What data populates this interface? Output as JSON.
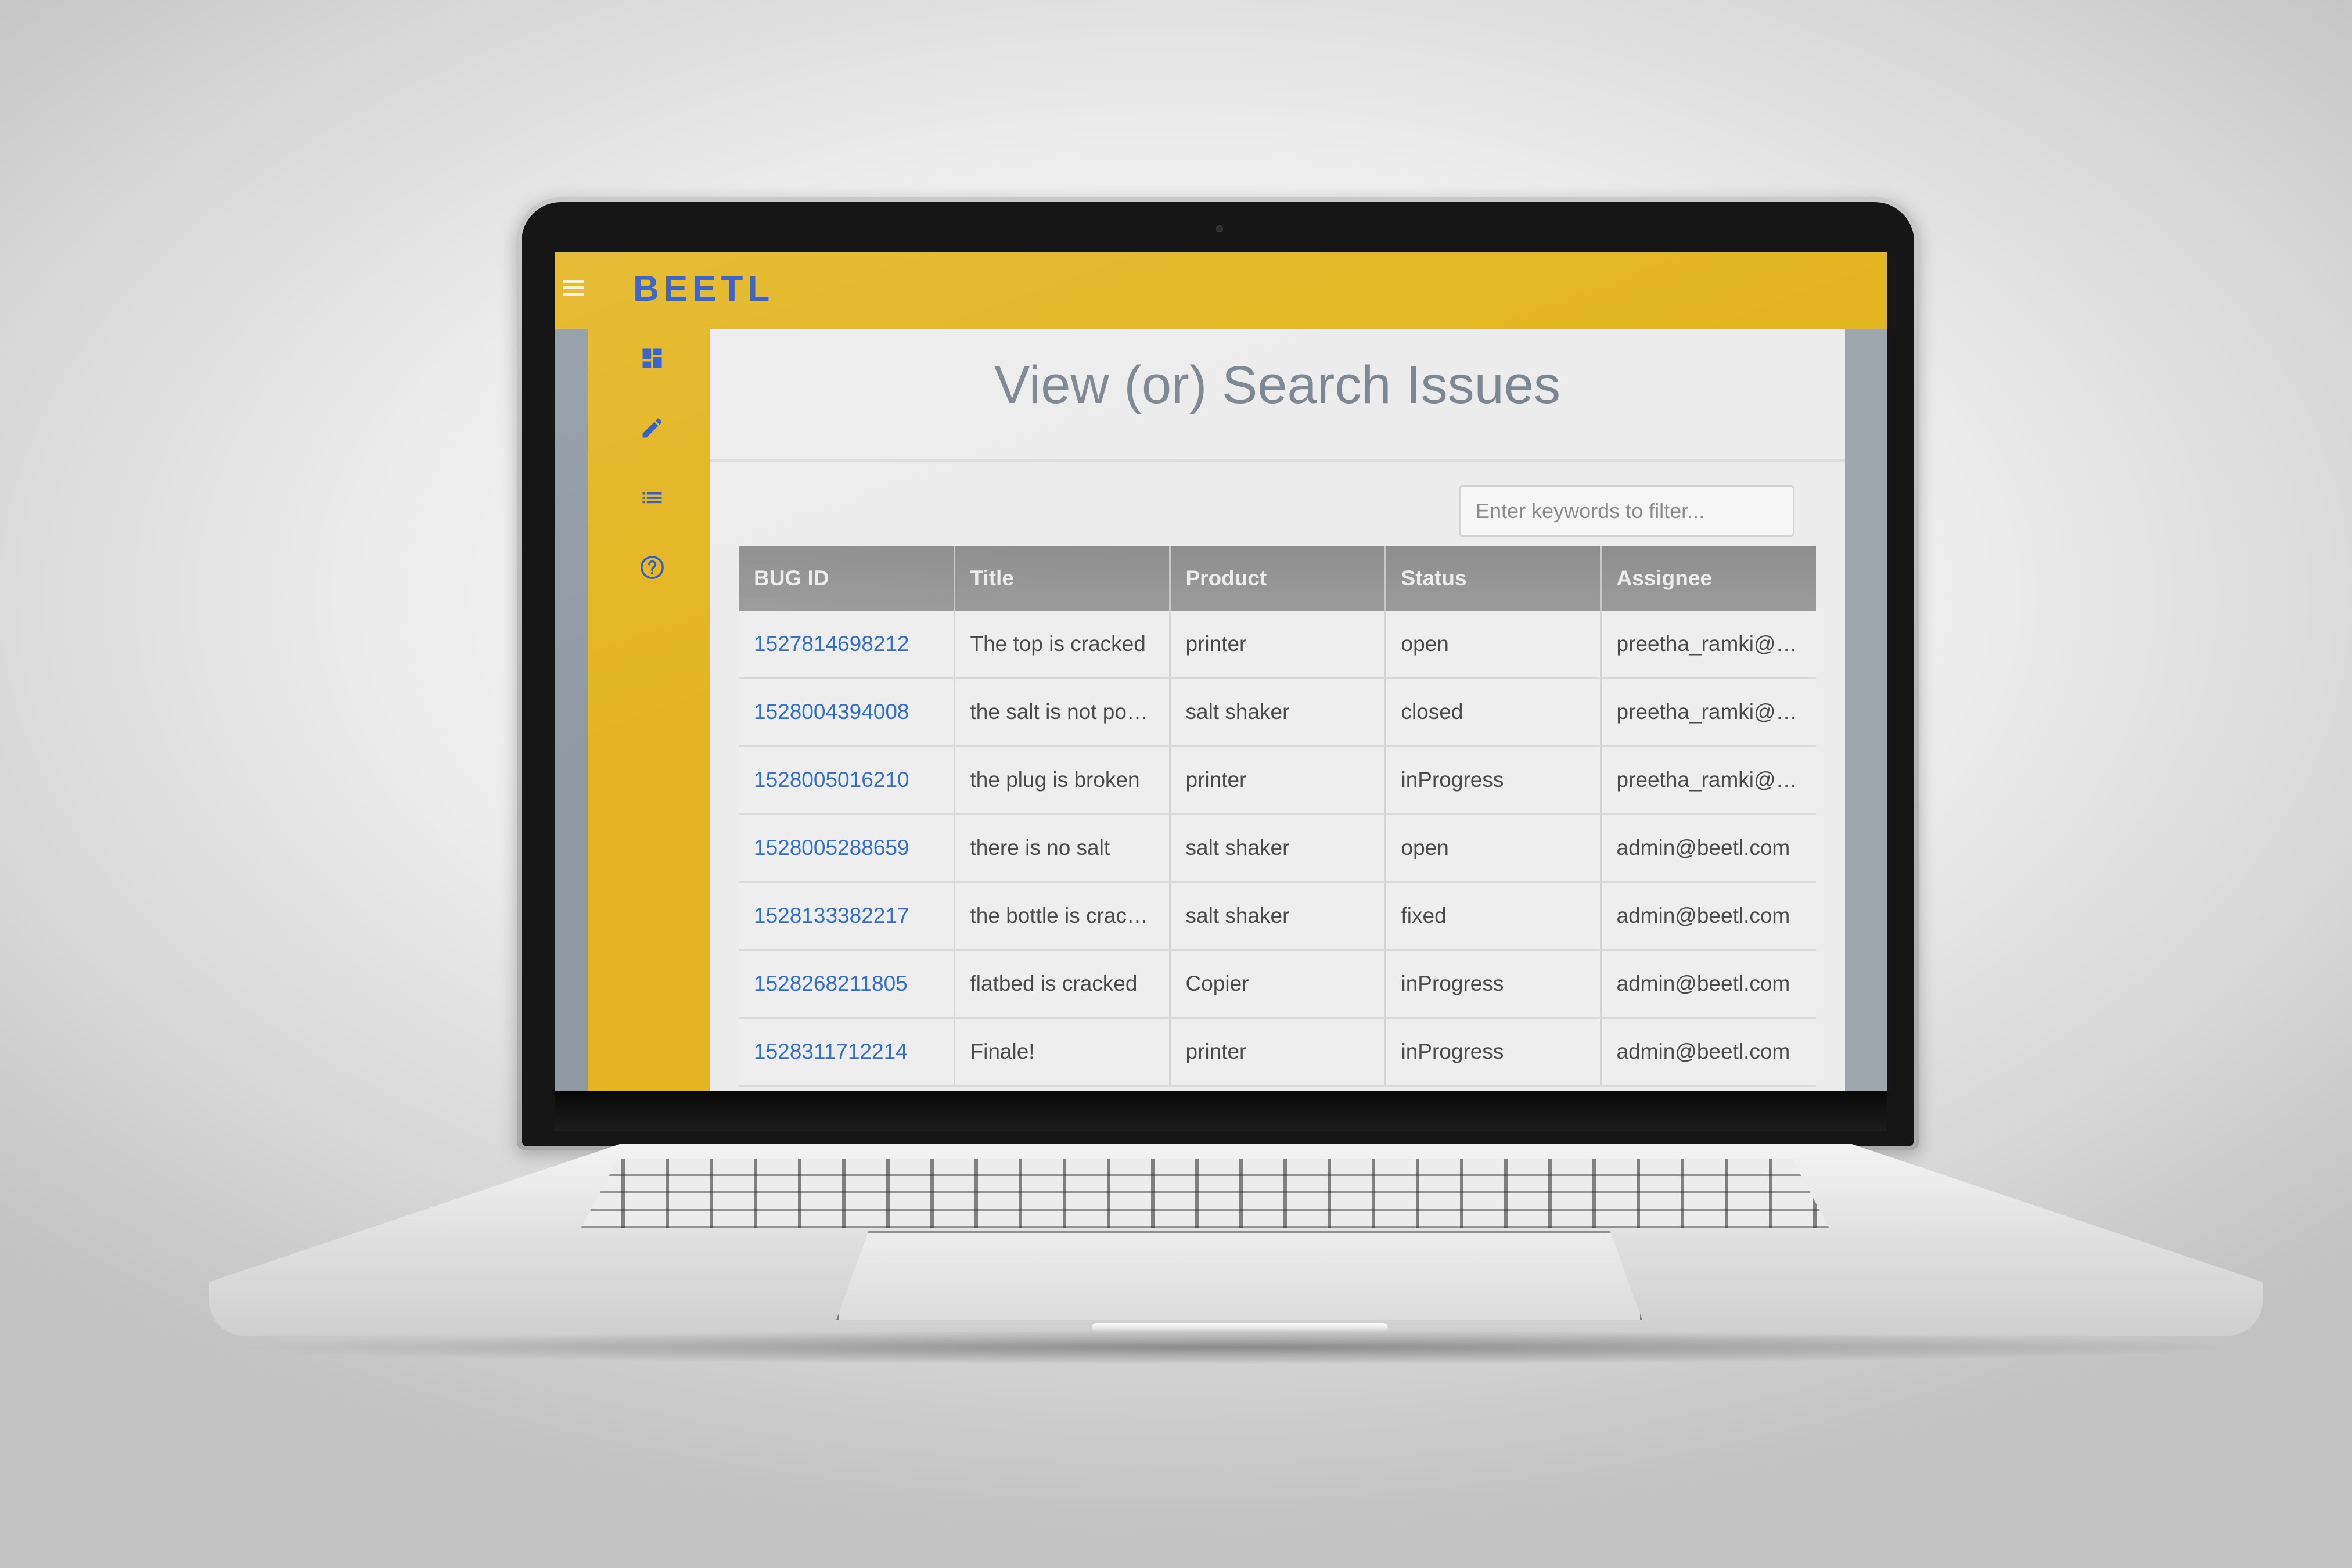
{
  "app": {
    "brand": "BEETL",
    "page_title": "View (or) Search Issues",
    "accent_color": "#e3b520",
    "brand_color": "#2a58c6",
    "link_color": "#2f6fcf"
  },
  "sidebar": {
    "items": [
      {
        "icon": "dashboard-icon"
      },
      {
        "icon": "pencil-icon"
      },
      {
        "icon": "list-icon"
      },
      {
        "icon": "help-icon"
      }
    ]
  },
  "filter": {
    "placeholder": "Enter keywords to filter...",
    "value": ""
  },
  "table": {
    "headers": {
      "bug_id": "BUG ID",
      "title": "Title",
      "product": "Product",
      "status": "Status",
      "assignee": "Assignee"
    },
    "rows": [
      {
        "bug_id": "1527814698212",
        "title": "The top is cracked",
        "product": "printer",
        "status": "open",
        "assignee": "preetha_ramki@h..."
      },
      {
        "bug_id": "1528004394008",
        "title": "the salt is not pour...",
        "product": "salt shaker",
        "status": "closed",
        "assignee": "preetha_ramki@h..."
      },
      {
        "bug_id": "1528005016210",
        "title": "the plug is broken",
        "product": "printer",
        "status": "inProgress",
        "assignee": "preetha_ramki@h..."
      },
      {
        "bug_id": "1528005288659",
        "title": "there is no salt",
        "product": "salt shaker",
        "status": "open",
        "assignee": "admin@beetl.com"
      },
      {
        "bug_id": "1528133382217",
        "title": "the bottle is cracked",
        "product": "salt shaker",
        "status": "fixed",
        "assignee": "admin@beetl.com"
      },
      {
        "bug_id": "1528268211805",
        "title": "flatbed is cracked",
        "product": "Copier",
        "status": "inProgress",
        "assignee": "admin@beetl.com"
      },
      {
        "bug_id": "1528311712214",
        "title": "Finale!",
        "product": "printer",
        "status": "inProgress",
        "assignee": "admin@beetl.com"
      }
    ]
  }
}
